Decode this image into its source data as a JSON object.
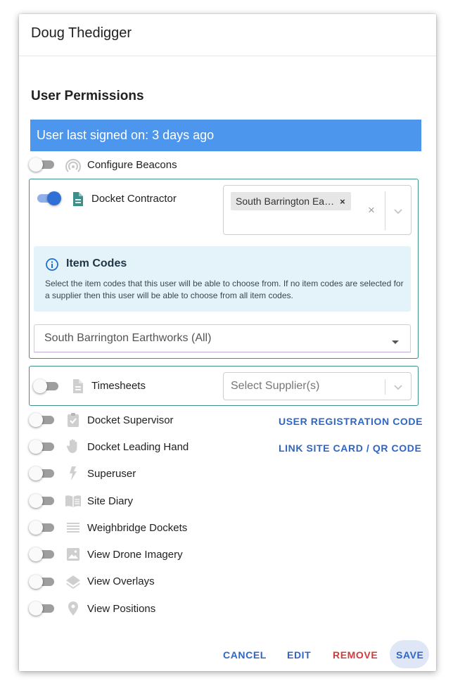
{
  "header": {
    "title": "Doug Thedigger"
  },
  "section": {
    "title": "User Permissions"
  },
  "banner": {
    "text": "User last signed on: 3 days ago"
  },
  "permissions": [
    {
      "label": "Configure Beacons",
      "enabled": false,
      "icon": "beacon-icon"
    },
    {
      "label": "Docket Contractor",
      "enabled": true,
      "icon": "document-icon"
    },
    {
      "label": "Timesheets",
      "enabled": false,
      "icon": "document-icon"
    },
    {
      "label": "Docket Supervisor",
      "enabled": false,
      "icon": "clipboard-check-icon"
    },
    {
      "label": "Docket Leading Hand",
      "enabled": false,
      "icon": "hand-icon"
    },
    {
      "label": "Superuser",
      "enabled": false,
      "icon": "lightning-icon"
    },
    {
      "label": "Site Diary",
      "enabled": false,
      "icon": "book-icon"
    },
    {
      "label": "Weighbridge Dockets",
      "enabled": false,
      "icon": "list-icon"
    },
    {
      "label": "View Drone Imagery",
      "enabled": false,
      "icon": "image-icon"
    },
    {
      "label": "View Overlays",
      "enabled": false,
      "icon": "layers-icon"
    },
    {
      "label": "View Positions",
      "enabled": false,
      "icon": "location-pin-icon"
    }
  ],
  "contractor": {
    "selected_chip": "South Barrington Ea…",
    "chip_remove": "×",
    "clear": "×",
    "item_codes": {
      "title": "Item Codes",
      "description": "Select the item codes that this user will be able to choose from. If no item codes are selected for a supplier then this user will be able to choose from all item codes.",
      "dropdown_value": "South Barrington Earthworks (All)"
    }
  },
  "timesheets": {
    "placeholder": "Select Supplier(s)"
  },
  "links": {
    "registration_code": "USER REGISTRATION CODE",
    "site_card": "LINK SITE CARD / QR CODE"
  },
  "footer": {
    "cancel": "CANCEL",
    "edit": "EDIT",
    "remove": "REMOVE",
    "save": "SAVE"
  },
  "colors": {
    "accent": "#2f6fd6",
    "banner": "#4c96ee",
    "remove": "#d13b3b",
    "border_teal": "#3c8f8b"
  }
}
